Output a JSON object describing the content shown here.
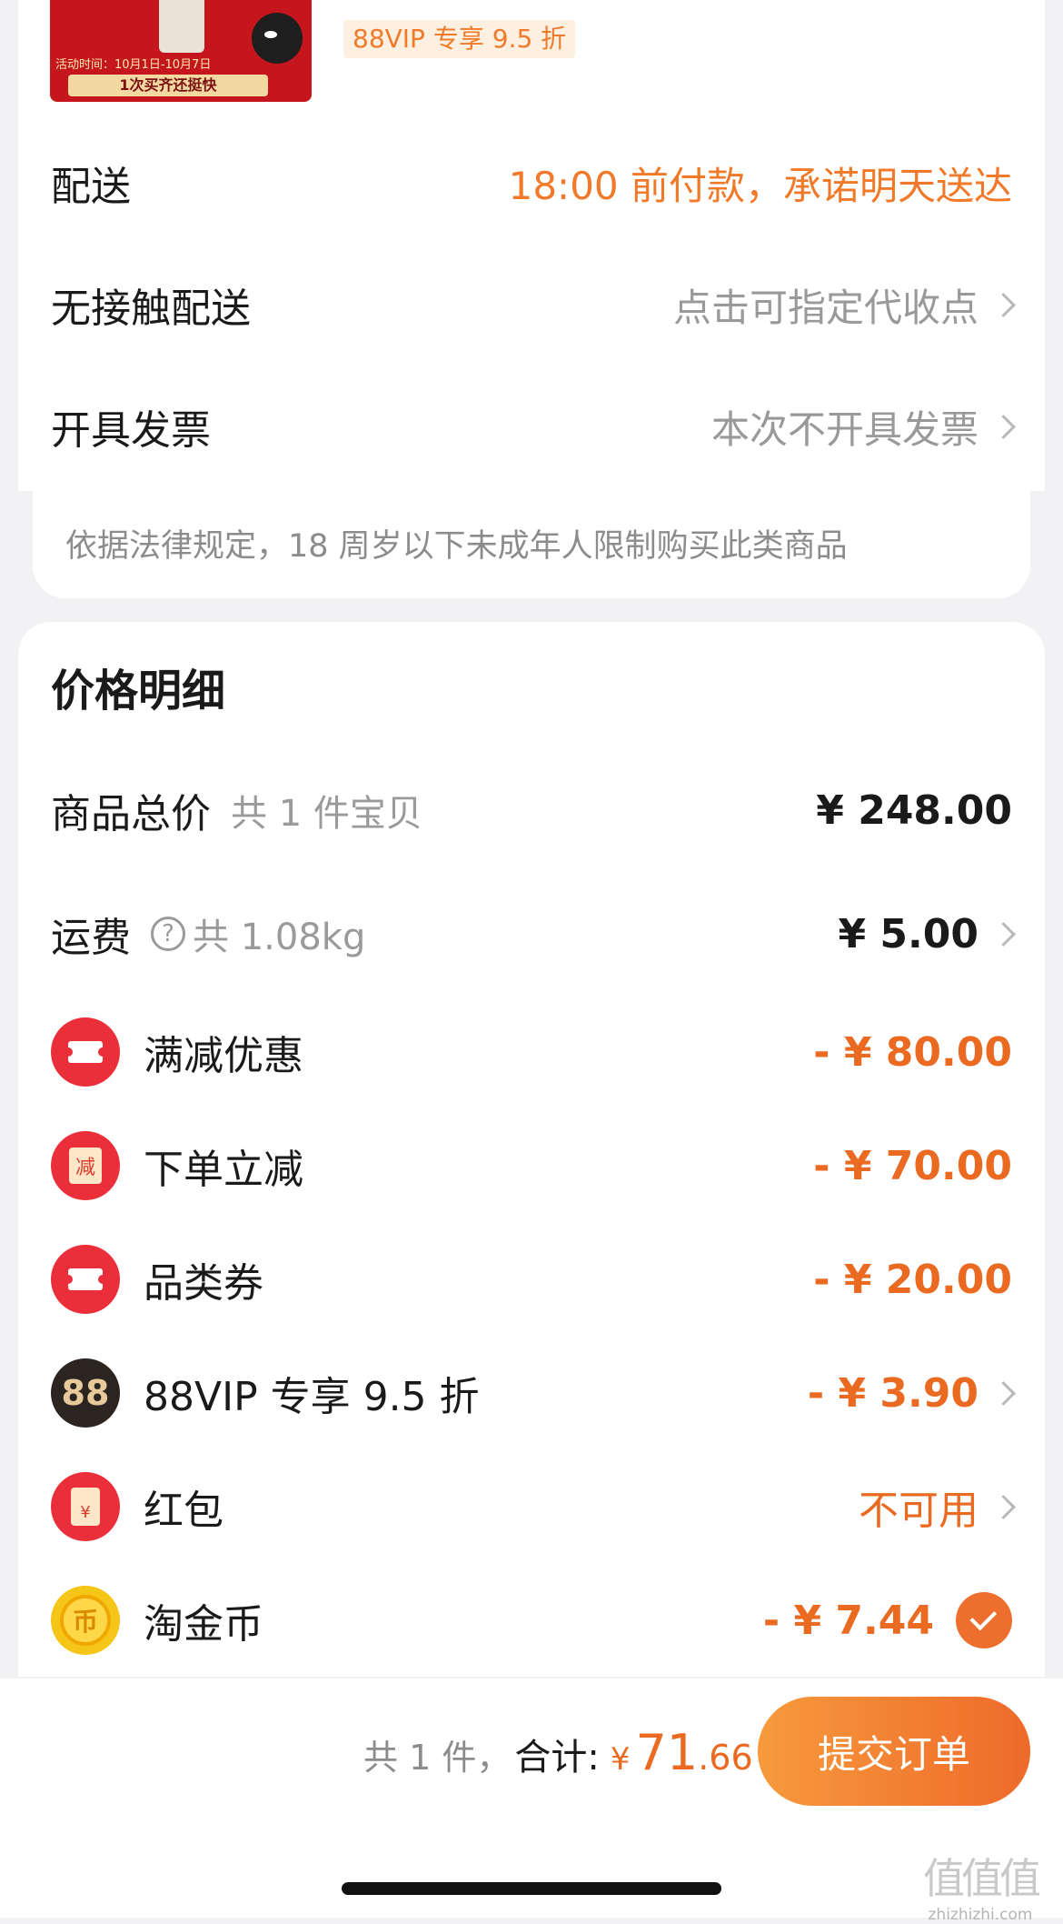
{
  "product": {
    "vip_tag": "88VIP 专享 9.5 折",
    "thumb_activity": "活动时间：10月1日-10月7日",
    "thumb_promo": "1次买齐还挺快"
  },
  "order_rows": [
    {
      "label": "配送",
      "value": "18:00 前付款，承诺明天送达"
    },
    {
      "label": "无接触配送",
      "value": "点击可指定代收点"
    },
    {
      "label": "开具发票",
      "value": "本次不开具发票"
    }
  ],
  "notice": "依据法律规定，18 周岁以下未成年人限制购买此类商品",
  "price_detail": {
    "title": "价格明细",
    "goods_total": {
      "label": "商品总价",
      "sub": "共 1 件宝贝",
      "amount": "¥ 248.00"
    },
    "shipping": {
      "label": "运费",
      "sub": "共 1.08kg",
      "amount": "¥ 5.00",
      "help_icon": "?"
    },
    "discounts": [
      {
        "icon": "ticket-icon",
        "label": "满减优惠",
        "amount": "- ¥ 80.00"
      },
      {
        "icon": "instant-reduction-icon",
        "icon_text": "减",
        "label": "下单立减",
        "amount": "- ¥ 70.00"
      },
      {
        "icon": "ticket-icon",
        "label": "品类券",
        "amount": "- ¥ 20.00"
      },
      {
        "icon": "vip88-icon",
        "icon_text": "88",
        "label": "88VIP 专享 9.5 折",
        "amount": "- ¥ 3.90"
      },
      {
        "icon": "red-packet-icon",
        "icon_text": "¥",
        "label": "红包",
        "amount": "不可用"
      },
      {
        "icon": "gold-coin-icon",
        "icon_text": "币",
        "label": "淘金币",
        "amount": "- ¥ 7.44"
      }
    ]
  },
  "footer": {
    "count": "共 1 件，",
    "total_label": "合计:",
    "currency": "¥",
    "total_int": "71",
    "total_dec": ".66",
    "submit_label": "提交订单"
  },
  "watermark": {
    "main": "值值值",
    "site": "zhizhizhi.com"
  },
  "colors": {
    "accent": "#ea6a22",
    "button_start": "#f79a3c",
    "button_end": "#ee6a2a",
    "background": "#f2f2f4"
  }
}
